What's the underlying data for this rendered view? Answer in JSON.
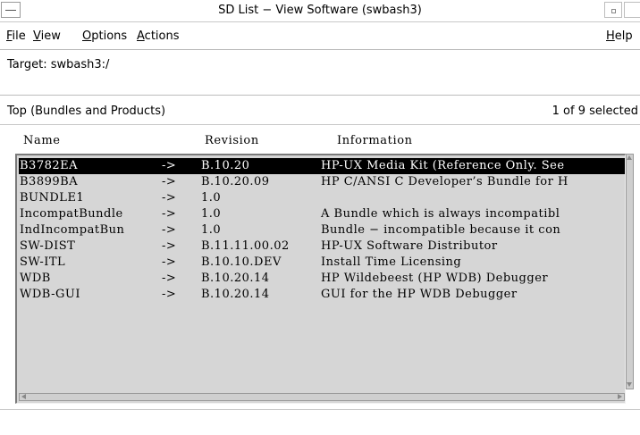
{
  "window": {
    "title": "SD List − View Software (swbash3)"
  },
  "menubar": {
    "file": {
      "mnemonic": "F",
      "rest": "ile"
    },
    "view": {
      "mnemonic": "V",
      "rest": "iew"
    },
    "options": {
      "mnemonic": "O",
      "rest": "ptions"
    },
    "actions": {
      "mnemonic": "A",
      "rest": "ctions"
    },
    "help": {
      "mnemonic": "H",
      "rest": "elp"
    }
  },
  "target": "Target:  swbash3:/",
  "list_header": {
    "level": "Top (Bundles and Products)",
    "selection_count": "1 of 9 selected"
  },
  "columns": {
    "name": "Name",
    "revision": "Revision",
    "information": "Information"
  },
  "rows": [
    {
      "name": "B3782EA",
      "arrow": "->",
      "revision": "B.10.20",
      "information": "HP-UX Media Kit (Reference Only. See",
      "selected": true
    },
    {
      "name": "B3899BA",
      "arrow": "->",
      "revision": "B.10.20.09",
      "information": "HP C/ANSI C Developer’s Bundle for H",
      "selected": false
    },
    {
      "name": "BUNDLE1",
      "arrow": "->",
      "revision": "1.0",
      "information": "",
      "selected": false
    },
    {
      "name": "IncompatBundle",
      "arrow": "->",
      "revision": "1.0",
      "information": "A Bundle which is always incompatibl",
      "selected": false
    },
    {
      "name": "IndIncompatBun",
      "arrow": "->",
      "revision": "1.0",
      "information": "Bundle − incompatible because it con",
      "selected": false
    },
    {
      "name": "SW-DIST",
      "arrow": "->",
      "revision": "B.11.11.00.02",
      "information": "HP-UX Software Distributor",
      "selected": false
    },
    {
      "name": "SW-ITL",
      "arrow": "->",
      "revision": "B.10.10.DEV",
      "information": "Install Time Licensing",
      "selected": false
    },
    {
      "name": "WDB",
      "arrow": "->",
      "revision": "B.10.20.14",
      "information": "HP Wildebeest (HP WDB) Debugger",
      "selected": false
    },
    {
      "name": "WDB-GUI",
      "arrow": "->",
      "revision": "B.10.20.14",
      "information": "GUI for the HP WDB Debugger",
      "selected": false
    }
  ],
  "colors": {
    "list_background": "#d6d6d6",
    "selection_background": "#000000",
    "selection_text": "#ffffff"
  }
}
